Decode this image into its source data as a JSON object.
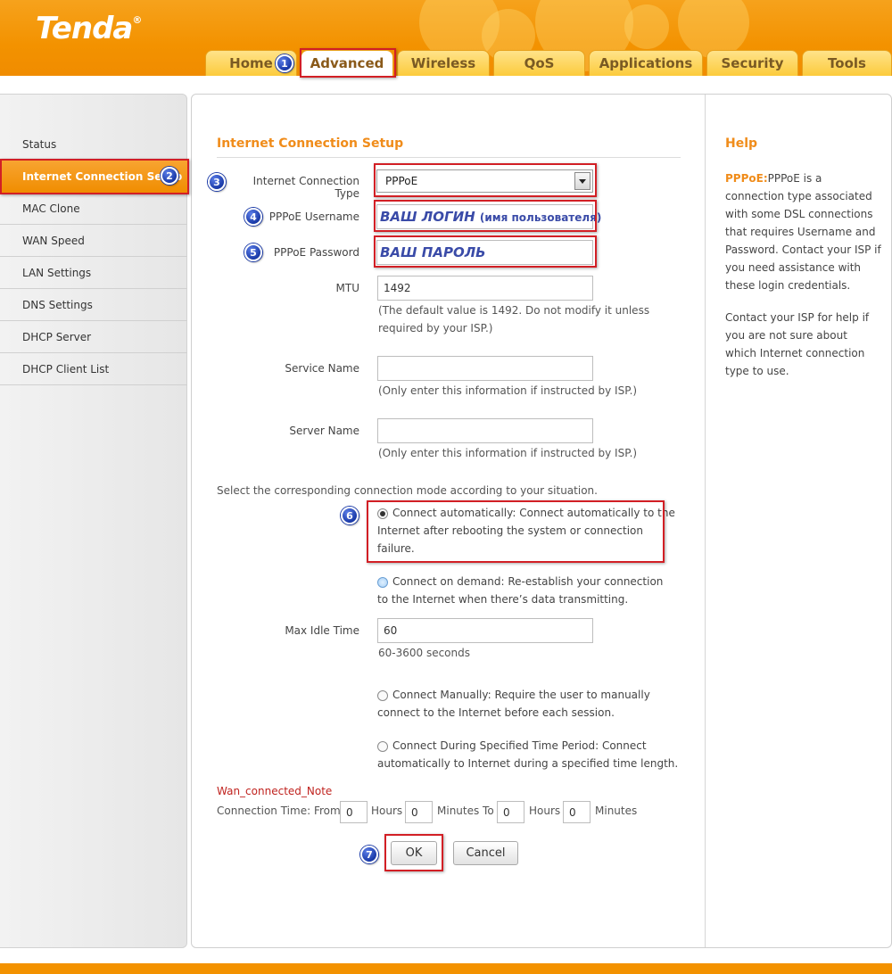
{
  "brand": {
    "logo": "Tenda",
    "reg": "®"
  },
  "colors": {
    "accent": "#f39200",
    "title": "#f08c1a",
    "annotation": "#d21f25",
    "marker": "#1a3aa8"
  },
  "tabs": [
    {
      "label": "Home"
    },
    {
      "label": "Advanced"
    },
    {
      "label": "Wireless"
    },
    {
      "label": "QoS"
    },
    {
      "label": "Applications"
    },
    {
      "label": "Security"
    },
    {
      "label": "Tools"
    }
  ],
  "sidebar": {
    "items": [
      {
        "label": "Status"
      },
      {
        "label": "Internet Connection Setup"
      },
      {
        "label": "MAC Clone"
      },
      {
        "label": "WAN Speed"
      },
      {
        "label": "LAN Settings"
      },
      {
        "label": "DNS Settings"
      },
      {
        "label": "DHCP Server"
      },
      {
        "label": "DHCP Client List"
      }
    ]
  },
  "markers": [
    "1",
    "2",
    "3",
    "4",
    "5",
    "6",
    "7"
  ],
  "form": {
    "title": "Internet Connection Setup",
    "conn_type_label": "Internet Connection Type",
    "conn_type_value": "PPPoE",
    "username_label": "PPPoE Username",
    "username_value": "ВАШ ЛОГИН",
    "username_suffix": "(имя пользователя)",
    "password_label": "PPPoE Password",
    "password_value": "ВАШ ПАРОЛЬ",
    "mtu_label": "MTU",
    "mtu_value": "1492",
    "mtu_hint_1": "(The default value is 1492. Do not modify it unless",
    "mtu_hint_2": "required by your ISP.)",
    "service_label": "Service Name",
    "service_value": "",
    "service_hint": "(Only enter this information if instructed by ISP.)",
    "server_label": "Server Name",
    "server_value": "",
    "server_hint": "(Only enter this information if instructed by ISP.)",
    "mode_intro": "Select the corresponding connection mode according to your situation.",
    "auto_1": "Connect automatically: Connect automatically to the",
    "auto_2": "Internet after rebooting the system or connection",
    "auto_3": "failure.",
    "demand_1": "Connect on demand: Re-establish your connection",
    "demand_2": "to the Internet when there’s data transmitting.",
    "idle_label": "Max Idle Time",
    "idle_value": "60",
    "idle_hint": "60-3600 seconds",
    "manual_1": "Connect Manually: Require the user to manually",
    "manual_2": "connect to the Internet before each session.",
    "period_1": "Connect During Specified Time Period: Connect",
    "period_2": "automatically to Internet during a specified time length.",
    "note": "Wan_connected_Note",
    "conn_time_label": "Connection Time: From",
    "hours1": "Hours",
    "minutes_to": "Minutes To",
    "hours2": "Hours",
    "minutes2": "Minutes",
    "from_h": "0",
    "from_m": "0",
    "to_h": "0",
    "to_m": "0",
    "ok": "OK",
    "cancel": "Cancel"
  },
  "help": {
    "title": "Help",
    "term": "PPPoE:",
    "p1_rest": "PPPoE is a",
    "lines1": [
      "connection type associated",
      "with some DSL connections",
      "that requires Username and",
      "Password. Contact your ISP if",
      "you need assistance with",
      "these login credentials."
    ],
    "lines2": [
      "Contact your ISP for help if",
      "you are not sure about",
      "which Internet connection",
      "type to use."
    ]
  }
}
